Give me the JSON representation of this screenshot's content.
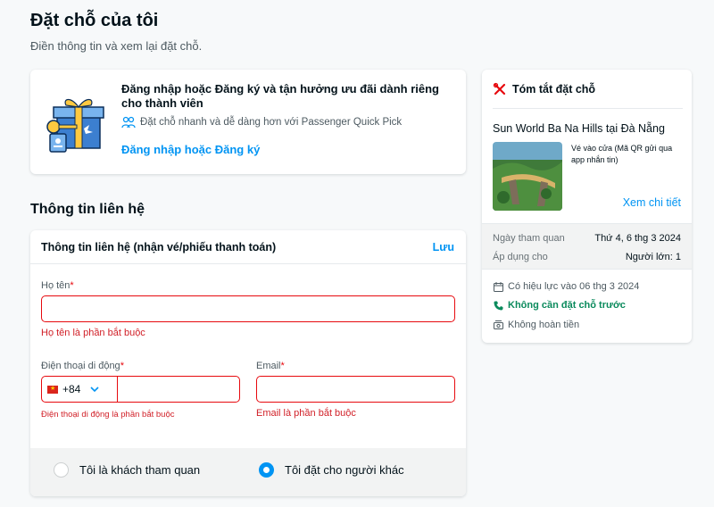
{
  "header": {
    "title": "Đặt chỗ của tôi",
    "subtitle": "Điền thông tin và xem lại đặt chỗ."
  },
  "login_card": {
    "title": "Đăng nhập hoặc Đăng ký và tận hưởng ưu đãi dành riêng cho thành viên",
    "quick_pick": "Đặt chỗ nhanh và dễ dàng hơn với Passenger Quick Pick",
    "link": "Đăng nhập hoặc Đăng ký",
    "icon": "gift-key-icon"
  },
  "contact": {
    "section_title": "Thông tin liên hệ",
    "card_title": "Thông tin liên hệ (nhận vé/phiếu thanh toán)",
    "save_label": "Lưu",
    "name_label": "Họ tên",
    "name_value": "",
    "name_error": "Họ tên là phần bắt buộc",
    "phone_label": "Điện thoại di động",
    "phone_code": "+84",
    "phone_value": "",
    "phone_error": "Điện thoại di động là phần bắt buộc",
    "email_label": "Email",
    "email_value": "",
    "email_error": "Email là phần bắt buộc",
    "required_mark": "*",
    "radio_visitor": "Tôi là khách tham quan",
    "radio_other": "Tôi đặt cho người khác",
    "selected_radio": "other"
  },
  "summary": {
    "title": "Tóm tắt đặt chỗ",
    "product_name": "Sun World Ba Na Hills tại Đà Nẵng",
    "ticket_desc": "Vé vào cửa (Mã QR gửi qua app nhắn tin)",
    "detail_link": "Xem chi tiết",
    "visit_date_label": "Ngày tham quan",
    "visit_date_value": "Thứ 4, 6 thg 3 2024",
    "applies_label": "Áp dụng cho",
    "applies_value": "Người lớn: 1",
    "valid_from": "Có hiệu lực vào 06 thg 3 2024",
    "no_reservation": "Không cần đặt chỗ trước",
    "no_refund": "Không hoàn tiền"
  },
  "colors": {
    "accent": "#0194f3",
    "error": "#e7090e",
    "success": "#0a8a5c"
  }
}
